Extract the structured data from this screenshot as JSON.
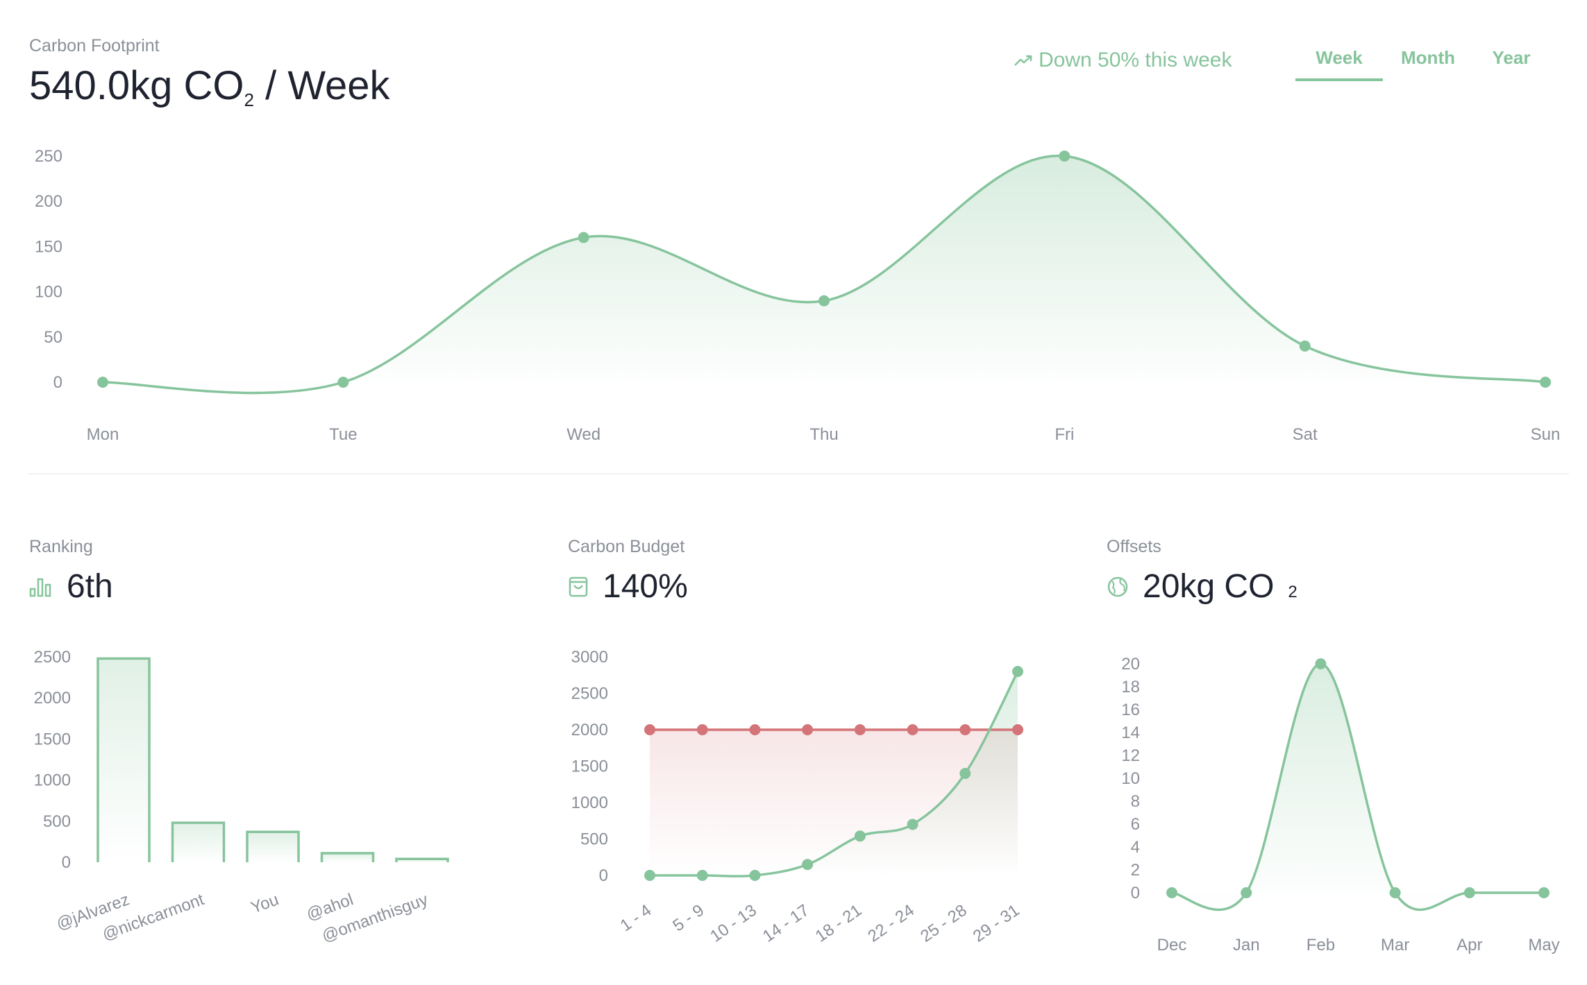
{
  "header": {
    "label": "Carbon Footprint",
    "value": "540.0kg CO",
    "sub": "2",
    "suffix": " / Week",
    "trend": "Down 50% this week",
    "tabs": [
      {
        "label": "Week"
      },
      {
        "label": "Month"
      },
      {
        "label": "Year"
      }
    ]
  },
  "panels": {
    "ranking": {
      "label": "Ranking",
      "value": "6th"
    },
    "budget": {
      "label": "Carbon Budget",
      "value": "140%"
    },
    "offsets": {
      "label": "Offsets",
      "value": "20kg CO",
      "sub": "2"
    }
  },
  "colors": {
    "accent": "#86c49c",
    "budget_line": "#d47478"
  },
  "icons": {
    "trend": "trending-up-icon",
    "ranking": "bar-chart-icon",
    "budget": "shopping-bag-icon",
    "offsets": "globe-icon"
  },
  "chart_data": [
    {
      "id": "weekly",
      "type": "area",
      "categories": [
        "Mon",
        "Tue",
        "Wed",
        "Thu",
        "Fri",
        "Sat",
        "Sun"
      ],
      "values": [
        0,
        0,
        160,
        90,
        250,
        40,
        0
      ],
      "yticks": [
        0,
        50,
        100,
        150,
        200,
        250
      ],
      "ylim": [
        0,
        250
      ]
    },
    {
      "id": "ranking",
      "type": "bar",
      "categories": [
        "@jAlvarez",
        "@nickcarmont",
        "You",
        "@ahol",
        "@omanthisguy"
      ],
      "values": [
        2480,
        480,
        370,
        110,
        40
      ],
      "yticks": [
        0,
        500,
        1000,
        1500,
        2000,
        2500
      ],
      "ylim": [
        0,
        2500
      ]
    },
    {
      "id": "budget",
      "type": "line",
      "categories": [
        "1 - 4",
        "5 - 9",
        "10 - 13",
        "14 - 17",
        "18 - 21",
        "22 - 24",
        "25 - 28",
        "29 - 31"
      ],
      "series": [
        {
          "values": [
            0,
            0,
            0,
            150,
            540,
            700,
            1400,
            2800
          ]
        },
        {
          "values": [
            2000,
            2000,
            2000,
            2000,
            2000,
            2000,
            2000,
            2000
          ]
        }
      ],
      "yticks": [
        0,
        500,
        1000,
        1500,
        2000,
        2500,
        3000
      ],
      "ylim": [
        0,
        3000
      ]
    },
    {
      "id": "offsets",
      "type": "area",
      "categories": [
        "Dec",
        "Jan",
        "Feb",
        "Mar",
        "Apr",
        "May"
      ],
      "values": [
        0,
        0,
        20,
        0,
        0,
        0
      ],
      "yticks": [
        0,
        2,
        4,
        6,
        8,
        10,
        12,
        14,
        16,
        18,
        20
      ],
      "ylim": [
        0,
        20
      ]
    }
  ]
}
